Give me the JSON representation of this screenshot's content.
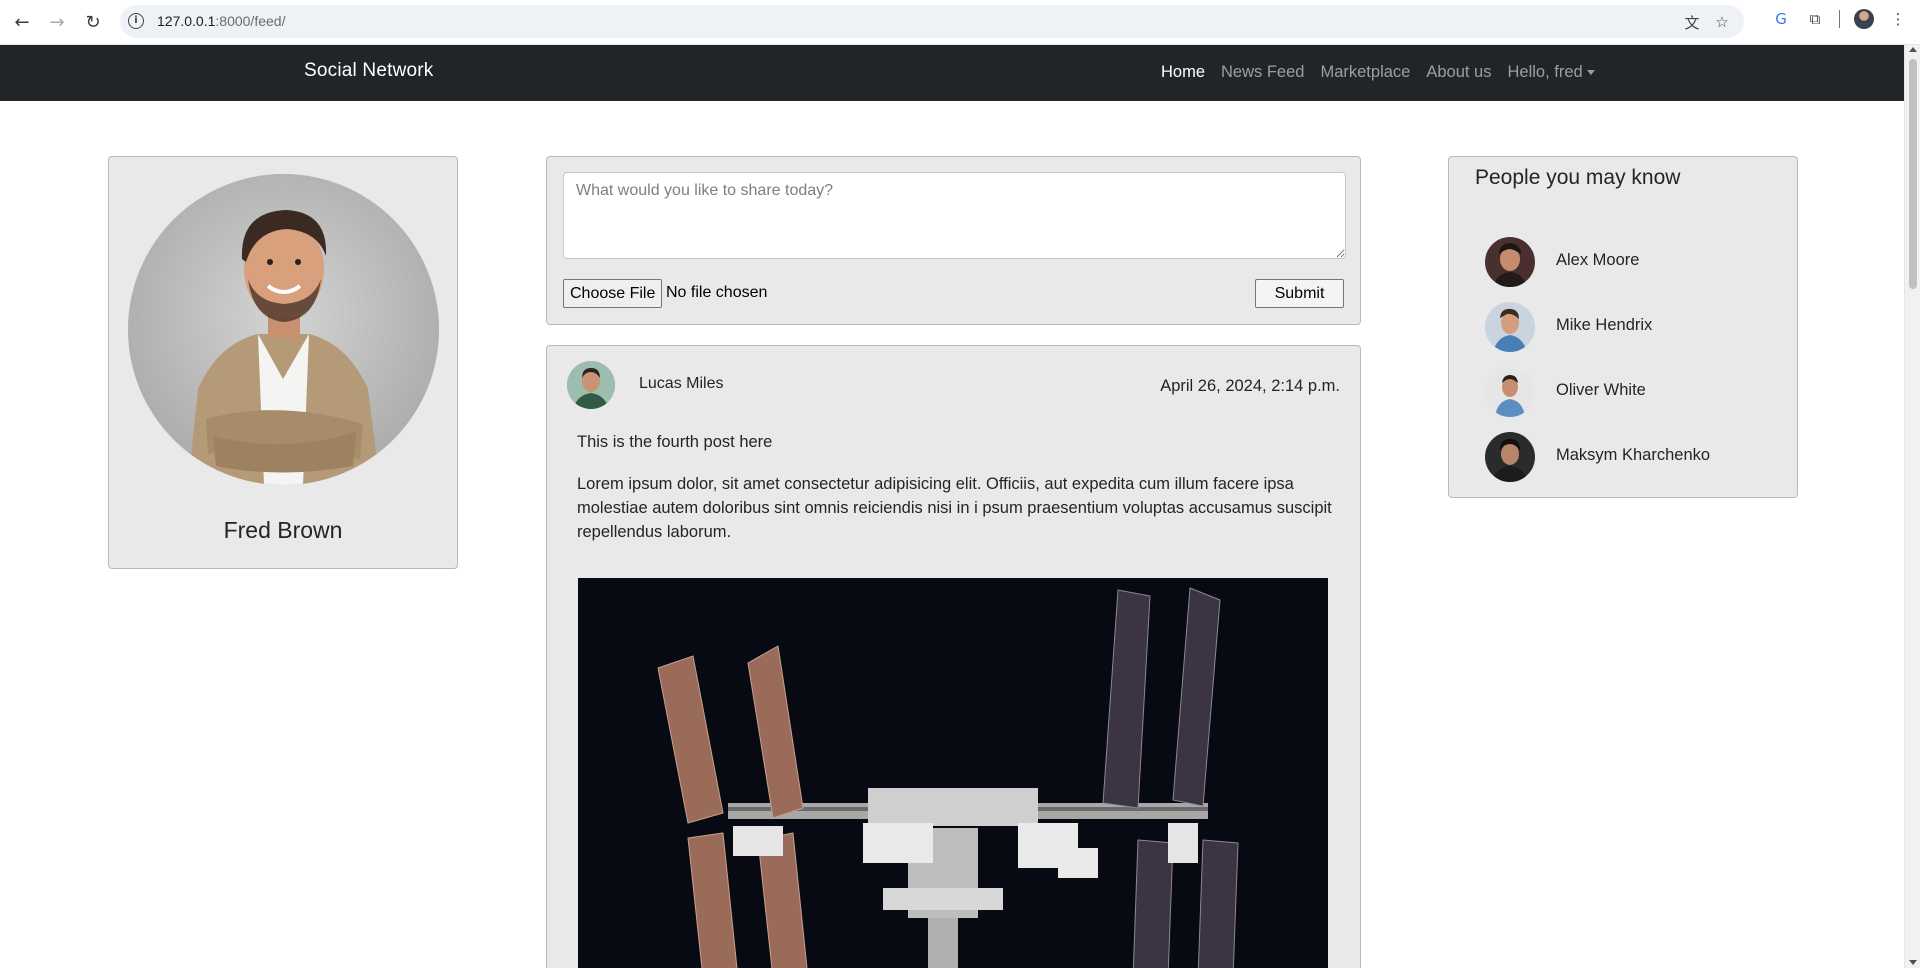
{
  "browser": {
    "url_host": "127.0.0.1",
    "url_rest": ":8000/feed/",
    "icons": [
      "back-arrow-icon",
      "forward-arrow-icon",
      "reload-icon",
      "site-info-icon",
      "translate-icon",
      "bookmark-star-icon",
      "google-translate-extension-icon",
      "extensions-puzzle-icon",
      "profile-avatar-icon",
      "menu-kebab-icon"
    ]
  },
  "navbar": {
    "brand": "Social Network",
    "links": [
      {
        "label": "Home",
        "active": true
      },
      {
        "label": "News Feed",
        "active": false
      },
      {
        "label": "Marketplace",
        "active": false
      },
      {
        "label": "About us",
        "active": false
      }
    ],
    "user_menu": "Hello, fred"
  },
  "profile": {
    "name": "Fred Brown"
  },
  "composer": {
    "placeholder": "What would you like to share today?",
    "file_button": "Choose File",
    "file_status": "No file chosen",
    "submit_label": "Submit"
  },
  "post": {
    "author": "Lucas Miles",
    "date": "April 26, 2024, 2:14 p.m.",
    "title": "This is the fourth post here",
    "body": "Lorem ipsum dolor, sit amet consectetur adipisicing elit. Officiis, aut expedita cum illum facere ipsa molestiae autem doloribus sint omnis reiciendis nisi in i psum praesentium voluptas accusamus suscipit repellendus laborum."
  },
  "people": {
    "heading": "People you may know",
    "list": [
      {
        "name": "Alex Moore"
      },
      {
        "name": "Mike Hendrix"
      },
      {
        "name": "Oliver White"
      },
      {
        "name": "Maksym Kharchenko"
      }
    ]
  },
  "colors": {
    "navbar_bg": "#212529",
    "card_bg": "#e9e9e9",
    "nav_active": "#ffffff",
    "nav_inactive": "rgba(255,255,255,0.55)"
  }
}
